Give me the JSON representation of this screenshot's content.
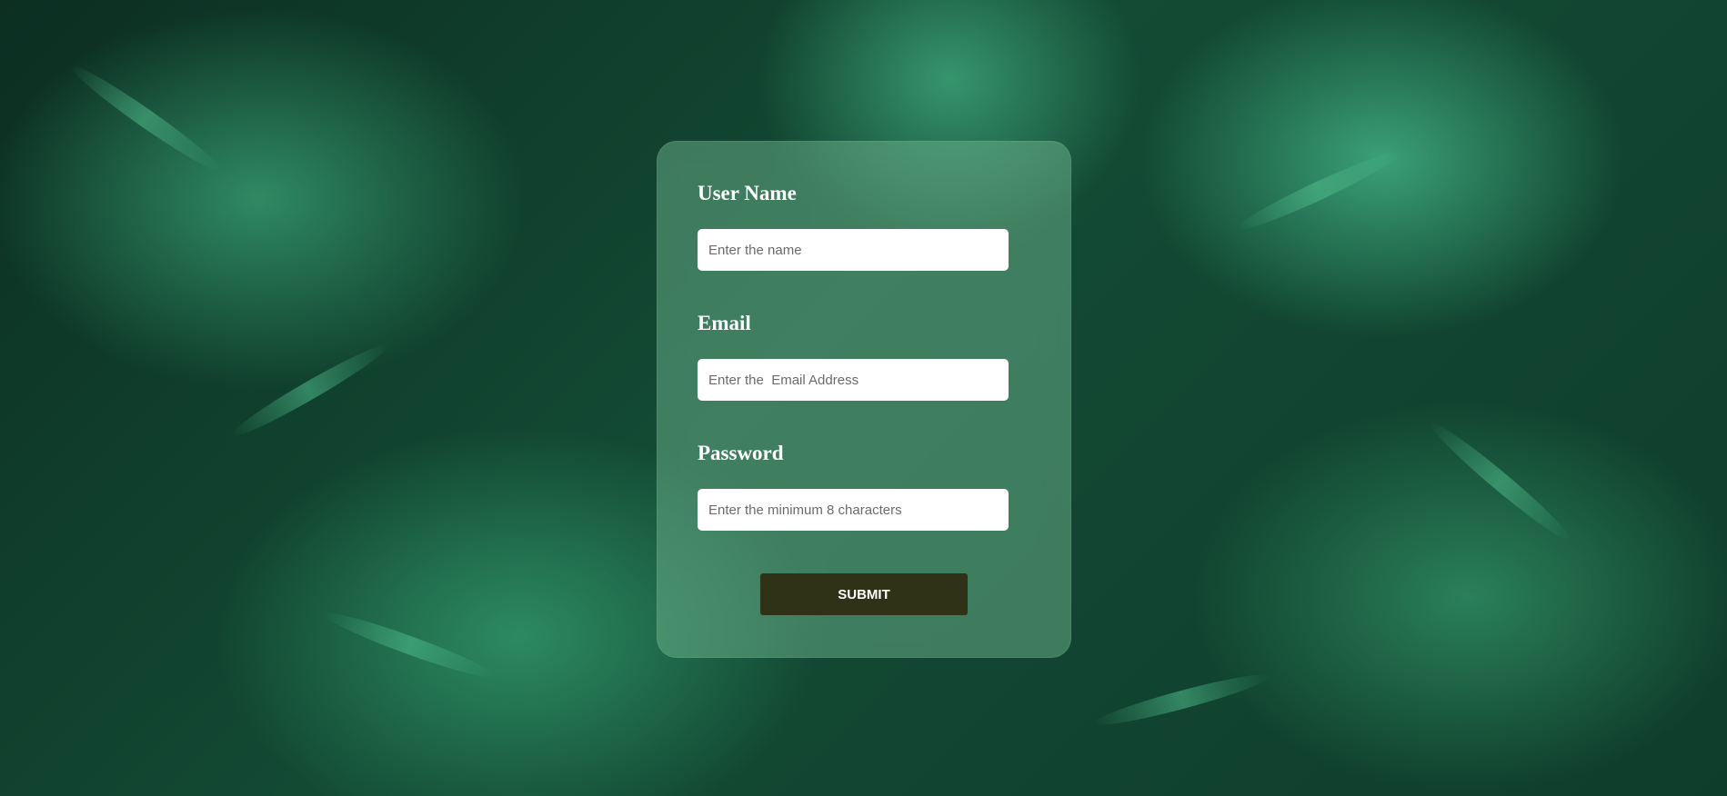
{
  "form": {
    "username_label": "User Name",
    "username_placeholder": "Enter the name",
    "email_label": "Email",
    "email_placeholder": "Enter the  Email Address",
    "password_label": "Password",
    "password_placeholder": "Enter the minimum 8 characters",
    "submit_label": "SUBMIT"
  },
  "colors": {
    "card_tint": "#78be96",
    "submit_bg": "#2f3217",
    "label_text": "#ffffff"
  }
}
